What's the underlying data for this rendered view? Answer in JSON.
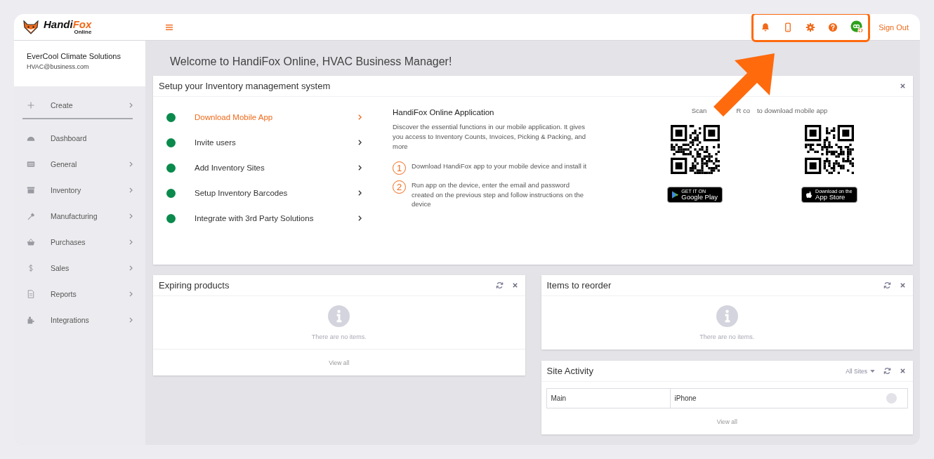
{
  "header": {
    "logo": {
      "first": "Handi",
      "second": "Fox",
      "sub": "Online"
    },
    "sign_out": "Sign Out"
  },
  "sidebar": {
    "company": "EverCool Climate Solutions",
    "email": "HVAC@business.com",
    "items": [
      {
        "label": "Create",
        "expandable": true
      },
      {
        "label": "Dashboard",
        "expandable": false
      },
      {
        "label": "General",
        "expandable": true
      },
      {
        "label": "Inventory",
        "expandable": true
      },
      {
        "label": "Manufacturing",
        "expandable": true
      },
      {
        "label": "Purchases",
        "expandable": true
      },
      {
        "label": "Sales",
        "expandable": true
      },
      {
        "label": "Reports",
        "expandable": true
      },
      {
        "label": "Integrations",
        "expandable": true
      }
    ]
  },
  "welcome": "Welcome to HandiFox Online, HVAC Business Manager!",
  "setup": {
    "title": "Setup your Inventory management system",
    "steps": [
      {
        "label": "Download Mobile App",
        "selected": true
      },
      {
        "label": "Invite users",
        "selected": false
      },
      {
        "label": "Add Inventory Sites",
        "selected": false
      },
      {
        "label": "Setup Inventory Barcodes",
        "selected": false
      },
      {
        "label": "Integrate with 3rd Party Solutions",
        "selected": false
      }
    ],
    "app": {
      "title": "HandiFox Online Application",
      "text": "Discover the essential functions in our mobile application. It gives you access to Inventory Counts, Invoices, Picking & Packing, and more",
      "instructions": [
        {
          "number": "1",
          "text": "Download HandiFox app to your mobile device and install it"
        },
        {
          "number": "2",
          "text": "Run app on the device, enter the email and password created on the previous step and follow instructions on the device"
        }
      ]
    },
    "qr_hint": [
      "Scan",
      "R co",
      "to download mobile app"
    ],
    "stores": [
      {
        "kind": "google",
        "small": "GET IT ON",
        "big": "Google Play"
      },
      {
        "kind": "apple",
        "small": "Download on the",
        "big": "App Store"
      }
    ]
  },
  "widgets_left": [
    {
      "title": "Expiring products",
      "empty": "There are no items.",
      "view_all": "View all"
    }
  ],
  "widgets_right": [
    {
      "title": "Items to reorder",
      "empty": "There are no items."
    },
    {
      "title": "Site Activity",
      "filter": "All Sites",
      "rows": [
        {
          "site": "Main",
          "device": "iPhone"
        }
      ],
      "view_all": "View all"
    }
  ]
}
